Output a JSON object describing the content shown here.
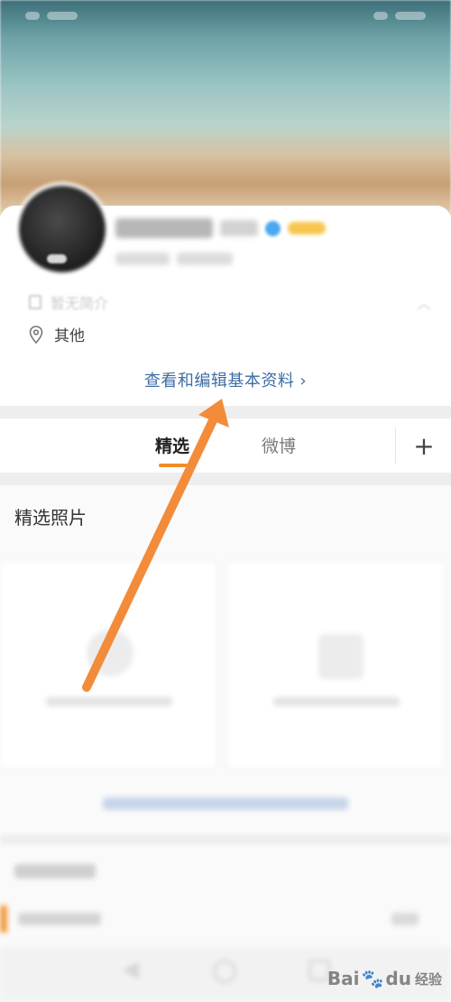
{
  "profile": {
    "intro_label": "暂无简介",
    "location_label": "其他",
    "edit_link_label": "查看和编辑基本资料",
    "edit_link_chevron": "›"
  },
  "tabs": {
    "items": [
      {
        "label": "精选",
        "active": true
      },
      {
        "label": "微博",
        "active": false
      }
    ],
    "add_label": "+"
  },
  "section": {
    "title": "精选照片"
  },
  "watermark": {
    "bai": "Bai",
    "paw": "🐾",
    "du": "du",
    "jingyan": "经验"
  },
  "annotation": {
    "arrow_color": "#f28c3a"
  },
  "colors": {
    "accent": "#f28c28",
    "link": "#3d6da4"
  }
}
